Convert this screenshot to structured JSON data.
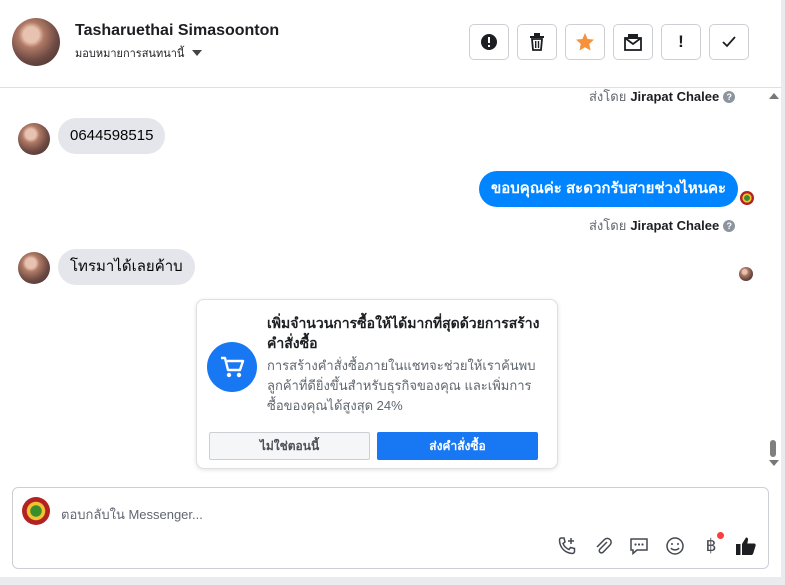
{
  "header": {
    "contact_name": "Tasharuethai Simasoonton",
    "assign_label": "มอบหมายการสนทนานี้",
    "toolbar": [
      {
        "name": "alert-button",
        "icon": "exclamation-circle-icon",
        "glyph": "❗"
      },
      {
        "name": "delete-button",
        "icon": "trash-icon",
        "glyph": "🗑"
      },
      {
        "name": "star-button",
        "icon": "star-icon",
        "glyph": "★",
        "color": "#f7923b"
      },
      {
        "name": "mark-unread-button",
        "icon": "envelope-icon",
        "glyph": "✉"
      },
      {
        "name": "spam-button",
        "icon": "exclamation-icon",
        "glyph": "!"
      },
      {
        "name": "done-button",
        "icon": "check-icon",
        "glyph": "✓"
      }
    ]
  },
  "messages": {
    "sent_by_prefix": "ส่งโดย",
    "agent_name": "Jirapat Chalee",
    "help_glyph": "?",
    "incoming_1": "0644598515",
    "outgoing_1": "ขอบคุณค่ะ สะดวกรับสายช่วงไหนคะ",
    "incoming_2": "โทรมาได้เลยค้าบ"
  },
  "promo": {
    "title": "เพิ่มจำนวนการซื้อให้ได้มากที่สุดด้วยการสร้างคำสั่งซื้อ",
    "body": "การสร้างคำสั่งซื้อภายในแชทจะช่วยให้เราค้นพบลูกค้าที่ดียิ่งขึ้นสำหรับธุรกิจของคุณ และเพิ่มการซื้อของคุณได้สูงสุด 24%",
    "not_now": "ไม่ใช่ตอนนี้",
    "send_order": "ส่งคำสั่งซื้อ"
  },
  "composer": {
    "placeholder": "ตอบกลับใน Messenger...",
    "tools": [
      {
        "name": "call-add-icon",
        "glyph": "📞"
      },
      {
        "name": "attach-icon",
        "glyph": "📎"
      },
      {
        "name": "saved-replies-icon",
        "glyph": "💬"
      },
      {
        "name": "emoji-icon",
        "glyph": "☺"
      },
      {
        "name": "baht-icon",
        "glyph": "฿"
      },
      {
        "name": "like-icon",
        "glyph": "👍"
      }
    ]
  },
  "colors": {
    "accent": "#1877f2",
    "outgoing_bubble": "#0084ff",
    "incoming_bubble": "#e4e6eb",
    "star": "#f7923b",
    "notification_dot": "#fa3e3e"
  }
}
